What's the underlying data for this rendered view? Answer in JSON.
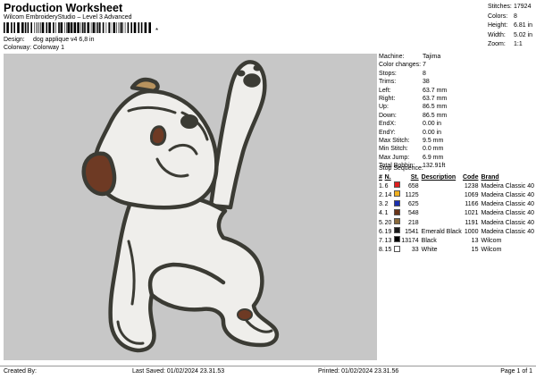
{
  "header": {
    "title": "Production Worksheet",
    "subtitle": "Wilcom EmbroideryStudio – Level 3 Advanced",
    "barcode_suffix": "*",
    "design_label": "Design:",
    "design_value": "dog applique v4 6,8 in",
    "colorway_label": "Colorway:",
    "colorway_value": "Colorway 1"
  },
  "top_stats": [
    {
      "label": "Stitches:",
      "value": "17924"
    },
    {
      "label": "Colors:",
      "value": "8"
    },
    {
      "label": "Height:",
      "value": "6.81 in"
    },
    {
      "label": "Width:",
      "value": "5.02 in"
    },
    {
      "label": "Zoom:",
      "value": "1:1"
    }
  ],
  "specs": [
    {
      "label": "Machine:",
      "value": "Tajima"
    },
    {
      "label": "Color changes:",
      "value": "7"
    },
    {
      "label": "Stops:",
      "value": "8"
    },
    {
      "label": "Trims:",
      "value": "38"
    },
    {
      "label": "Left:",
      "value": "63.7 mm"
    },
    {
      "label": "Right:",
      "value": "63.7 mm"
    },
    {
      "label": "Up:",
      "value": "86.5 mm"
    },
    {
      "label": "Down:",
      "value": "86.5 mm"
    },
    {
      "label": "EndX:",
      "value": "0.00 in"
    },
    {
      "label": "EndY:",
      "value": "0.00 in"
    },
    {
      "label": "Max Stitch:",
      "value": "9.5 mm"
    },
    {
      "label": "Min Stitch:",
      "value": "0.0 mm"
    },
    {
      "label": "Max Jump:",
      "value": "6.9 mm"
    },
    {
      "label": "Total Bobbin:",
      "value": "132.91ft"
    }
  ],
  "stop_sequence": {
    "title": "Stop Sequence:",
    "headers": [
      "#",
      "N.",
      "St.",
      "Description",
      "Code",
      "Brand"
    ],
    "rows": [
      {
        "num": "1.",
        "n": "6",
        "color": "#e02020",
        "st": "658",
        "desc": "",
        "code": "1238",
        "brand": "Madeira Classic 40"
      },
      {
        "num": "2.",
        "n": "14",
        "color": "#f0b020",
        "st": "1125",
        "desc": "",
        "code": "1069",
        "brand": "Madeira Classic 40"
      },
      {
        "num": "3.",
        "n": "2",
        "color": "#1a2fb0",
        "st": "625",
        "desc": "",
        "code": "1166",
        "brand": "Madeira Classic 40"
      },
      {
        "num": "4.",
        "n": "1",
        "color": "#6a3418",
        "st": "548",
        "desc": "",
        "code": "1021",
        "brand": "Madeira Classic 40"
      },
      {
        "num": "5.",
        "n": "20",
        "color": "#8a6a3a",
        "st": "218",
        "desc": "",
        "code": "1191",
        "brand": "Madeira Classic 40"
      },
      {
        "num": "6.",
        "n": "19",
        "color": "#1a1a1a",
        "st": "1541",
        "desc": "Emerald Black",
        "code": "1000",
        "brand": "Madeira Classic 40"
      },
      {
        "num": "7.",
        "n": "13",
        "color": "#000000",
        "st": "13174",
        "desc": "Black",
        "code": "13",
        "brand": "Wilcom"
      },
      {
        "num": "8.",
        "n": "15",
        "color": "#ffffff",
        "st": "33",
        "desc": "White",
        "code": "15",
        "brand": "Wilcom"
      }
    ]
  },
  "footer": {
    "created": "Created By:",
    "last_saved": "Last Saved: 01/02/2024 23.31.53",
    "printed": "Printed: 01/02/2024 23.31.56",
    "page": "Page 1 of 1"
  },
  "colors": {
    "canvas_bg": "#c7c7c7",
    "outline": "#3b3b34",
    "fill": "#efeeeb",
    "ear": "#6e3a24",
    "collar": "#b8935e"
  }
}
